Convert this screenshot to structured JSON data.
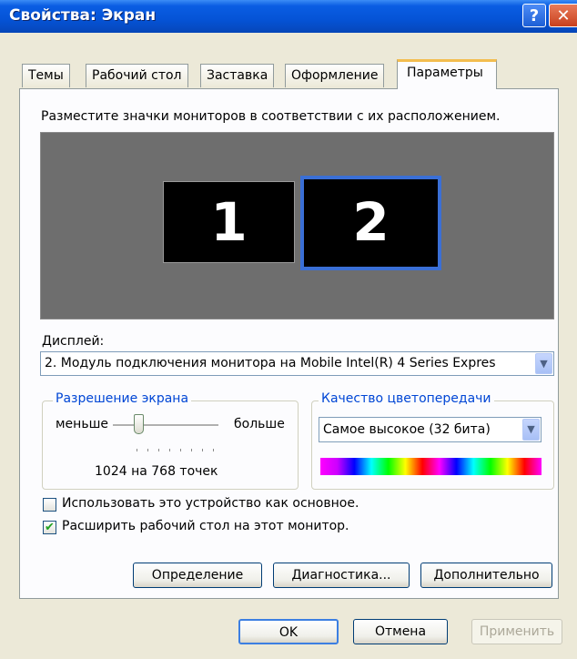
{
  "window": {
    "title": "Свойства: Экран",
    "help_glyph": "?",
    "close_glyph": "✕"
  },
  "tabs": [
    {
      "label": "Темы"
    },
    {
      "label": "Рабочий стол"
    },
    {
      "label": "Заставка"
    },
    {
      "label": "Оформление"
    },
    {
      "label": "Параметры",
      "active": true
    }
  ],
  "settings": {
    "instruction": "Разместите значки мониторов в соответствии с их расположением.",
    "monitors": [
      {
        "number": "1",
        "selected": false
      },
      {
        "number": "2",
        "selected": true
      }
    ],
    "display_label": "Дисплей:",
    "display_value": "2. Модуль подключения монитора на Mobile Intel(R) 4 Series Expres",
    "resolution": {
      "group_title": "Разрешение экрана",
      "less_label": "меньше",
      "more_label": "больше",
      "value_text": "1024 на 768 точек",
      "slider_level": 0.2
    },
    "color_quality": {
      "group_title": "Качество цветопередачи",
      "selected": "Самое высокое (32 бита)"
    },
    "checkboxes": [
      {
        "label": "Использовать это устройство как основное.",
        "checked": false
      },
      {
        "label": "Расширить рабочий стол на этот монитор.",
        "checked": true
      }
    ],
    "check_glyph": "✔",
    "buttons": {
      "identify": "Определение",
      "troubleshoot": "Диагностика...",
      "advanced": "Дополнительно"
    }
  },
  "footer": {
    "ok": "OK",
    "cancel": "Отмена",
    "apply": "Применить"
  },
  "colors": {
    "titlebar": "#0553d6",
    "dialog_bg": "#ece9d8",
    "group_title": "#0046d5",
    "monitor_bg": "#6e6e6e",
    "selected_monitor_border": "#3a6fd6"
  }
}
